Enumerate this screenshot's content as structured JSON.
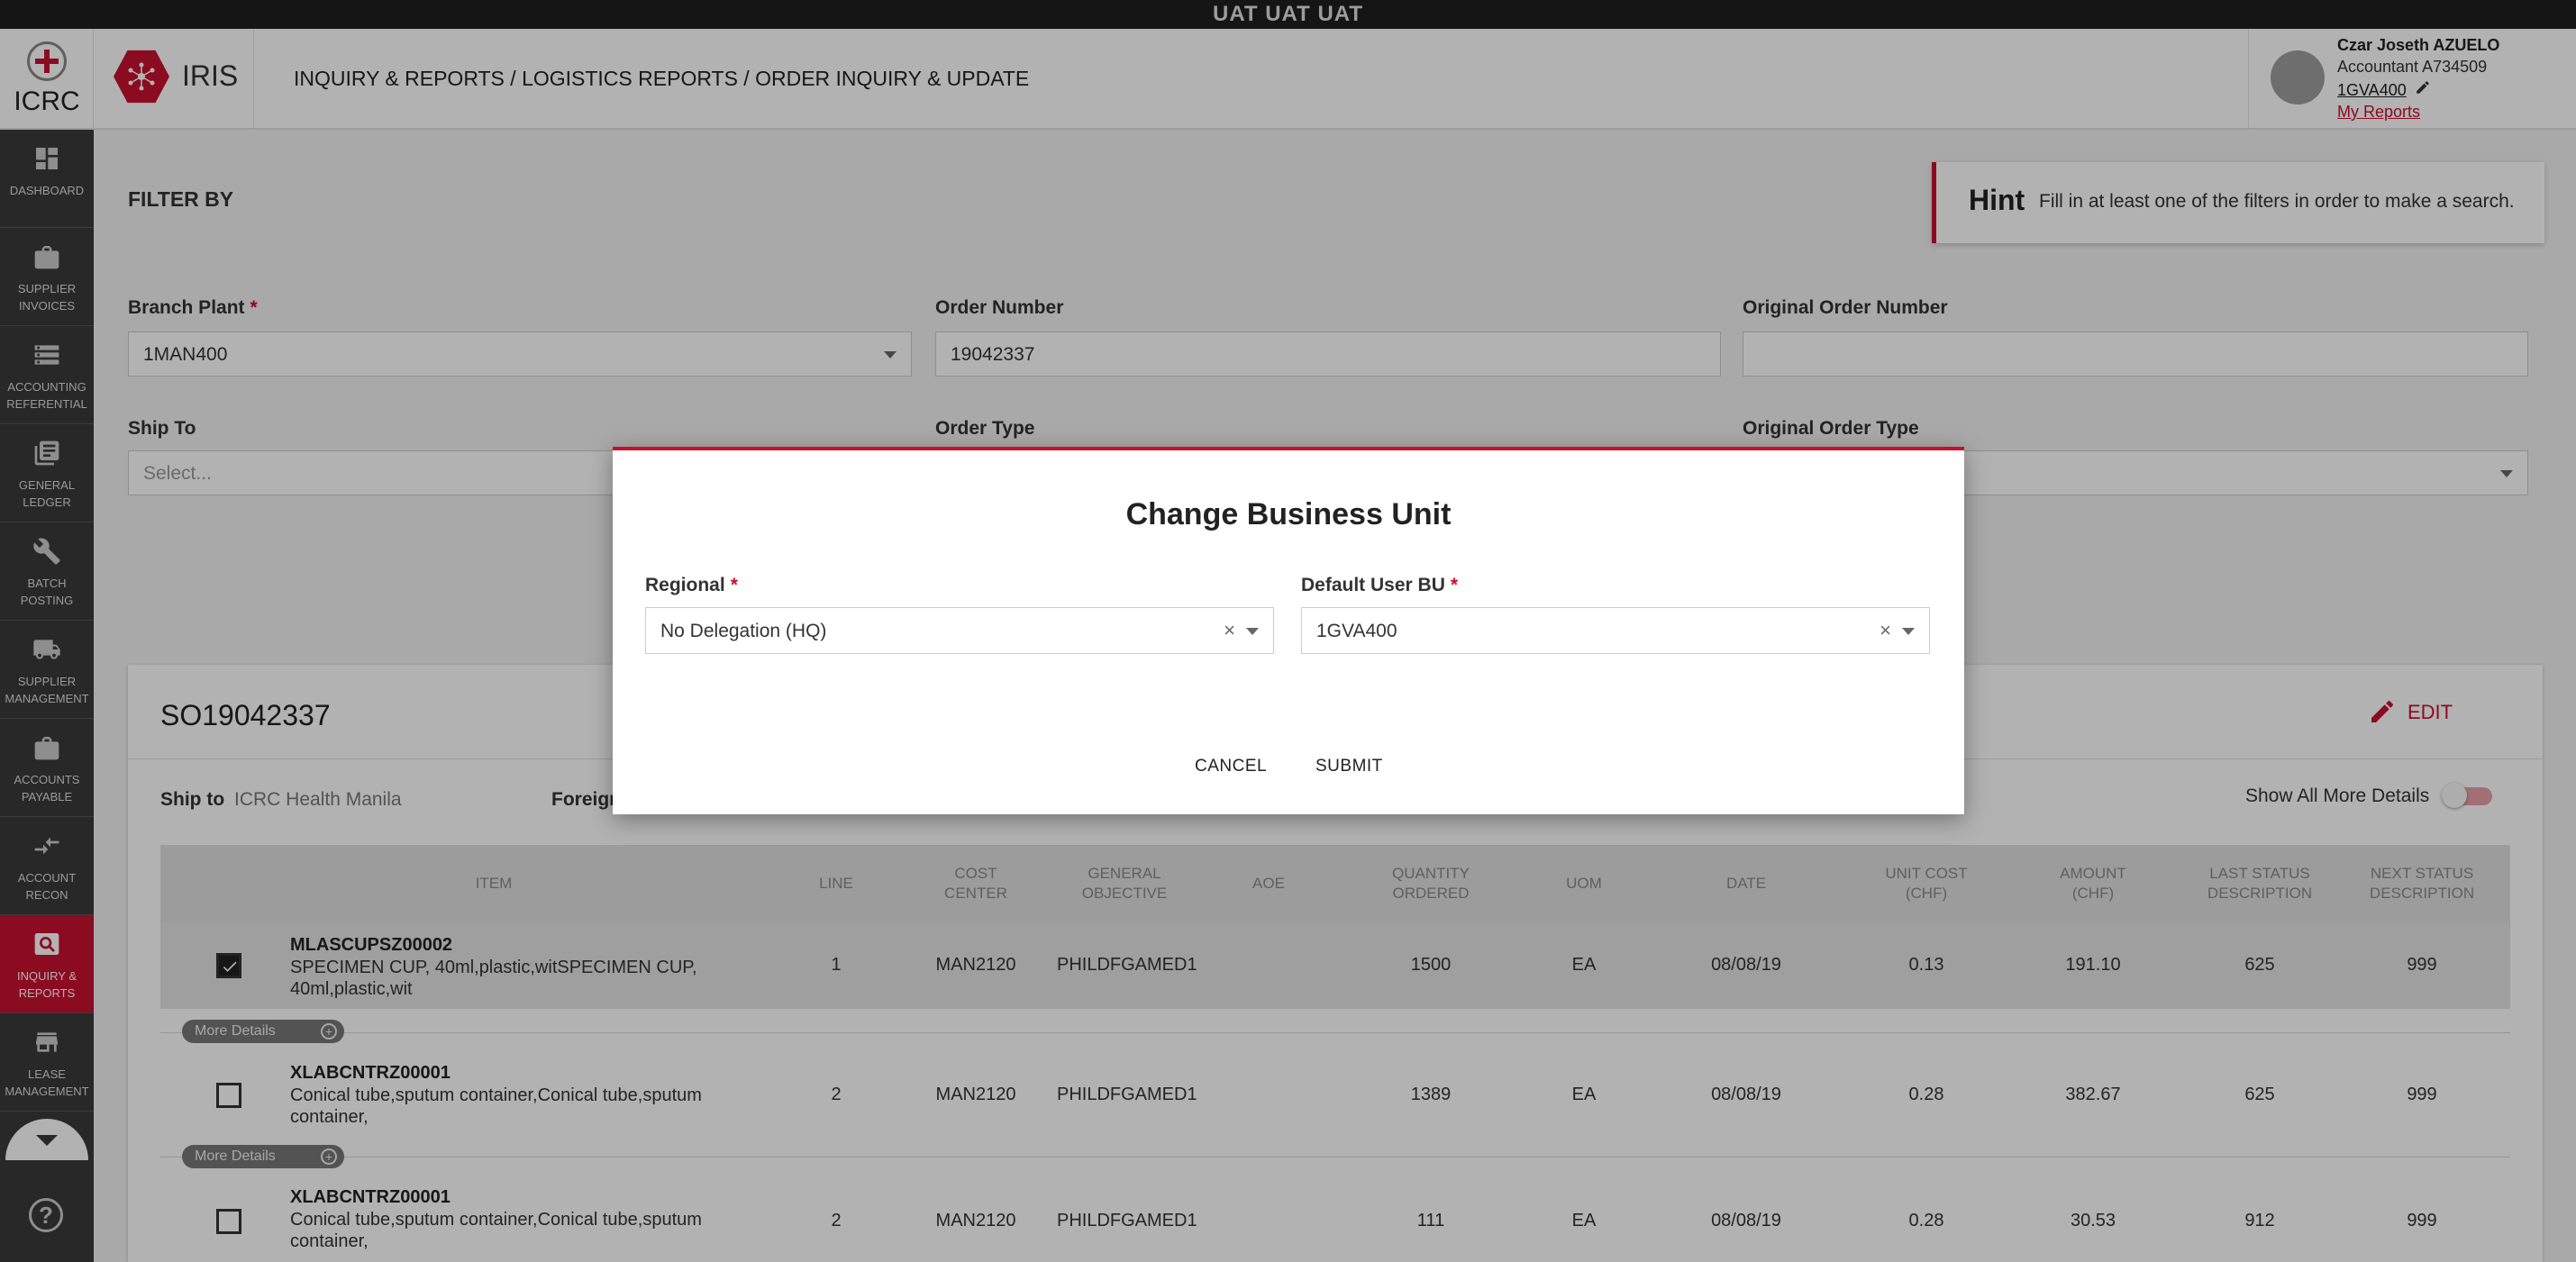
{
  "env_banner": "UAT UAT UAT",
  "brand": {
    "org": "ICRC",
    "app": "IRIS"
  },
  "breadcrumb": "INQUIRY & REPORTS / LOGISTICS REPORTS / ORDER INQUIRY & UPDATE",
  "user": {
    "name": "Czar Joseth AZUELO",
    "role": "Accountant A734509",
    "business_unit": "1GVA400",
    "my_reports": "My Reports"
  },
  "sidebar": {
    "items": [
      {
        "label": "DASHBOARD",
        "icon": "dashboard-icon"
      },
      {
        "label": "SUPPLIER INVOICES",
        "icon": "briefcase-icon"
      },
      {
        "label": "ACCOUNTING REFERENTIAL",
        "icon": "storage-icon"
      },
      {
        "label": "GENERAL LEDGER",
        "icon": "library-books-icon"
      },
      {
        "label": "BATCH POSTING",
        "icon": "wrench-icon"
      },
      {
        "label": "SUPPLIER MANAGEMENT",
        "icon": "truck-icon"
      },
      {
        "label": "ACCOUNTS PAYABLE",
        "icon": "briefcase-icon"
      },
      {
        "label": "ACCOUNT RECON",
        "icon": "compare-arrows-icon"
      },
      {
        "label": "INQUIRY & REPORTS",
        "icon": "search-icon",
        "active": true
      },
      {
        "label": "LEASE MANAGEMENT",
        "icon": "store-icon"
      }
    ]
  },
  "filter": {
    "title": "FILTER BY",
    "hint_title": "Hint",
    "hint_text": "Fill in at least one of the filters in order to make a search.",
    "branch_plant_label": "Branch Plant",
    "branch_plant_value": "1MAN400",
    "order_number_label": "Order Number",
    "order_number_value": "19042337",
    "original_order_number_label": "Original Order Number",
    "original_order_number_value": "",
    "ship_to_label": "Ship To",
    "ship_to_placeholder": "Select...",
    "order_type_label": "Order Type",
    "original_order_type_label": "Original Order Type"
  },
  "order": {
    "title": "SO19042337",
    "edit_label": "EDIT",
    "ship_to_label": "Ship to",
    "ship_to_value": "ICRC Health Manila",
    "foreign_label": "Foreign",
    "show_all_label": "Show All More Details",
    "columns": [
      "ITEM",
      "LINE",
      "COST CENTER",
      "GENERAL OBJECTIVE",
      "AOE",
      "QUANTITY ORDERED",
      "UOM",
      "DATE",
      "UNIT COST (CHF)",
      "AMOUNT (CHF)",
      "LAST STATUS DESCRIPTION",
      "NEXT STATUS DESCRIPTION"
    ],
    "more_details_label": "More Details",
    "rows": [
      {
        "checked": true,
        "item_code": "MLASCUPSZ00002",
        "item_desc": "SPECIMEN CUP, 40ml,plastic,witSPECIMEN CUP, 40ml,plastic,wit",
        "line": "1",
        "cost_center": "MAN2120",
        "general_objective": "PHILDFGAMED1",
        "aoe": "",
        "quantity": "1500",
        "uom": "EA",
        "date": "08/08/19",
        "unit_cost": "0.13",
        "amount": "191.10",
        "last_status": "625",
        "next_status": "999"
      },
      {
        "checked": false,
        "item_code": "XLABCNTRZ00001",
        "item_desc": "Conical tube,sputum container,Conical tube,sputum container,",
        "line": "2",
        "cost_center": "MAN2120",
        "general_objective": "PHILDFGAMED1",
        "aoe": "",
        "quantity": "1389",
        "uom": "EA",
        "date": "08/08/19",
        "unit_cost": "0.28",
        "amount": "382.67",
        "last_status": "625",
        "next_status": "999"
      },
      {
        "checked": false,
        "item_code": "XLABCNTRZ00001",
        "item_desc": "Conical tube,sputum container,Conical tube,sputum container,",
        "line": "2",
        "cost_center": "MAN2120",
        "general_objective": "PHILDFGAMED1",
        "aoe": "",
        "quantity": "111",
        "uom": "EA",
        "date": "08/08/19",
        "unit_cost": "0.28",
        "amount": "30.53",
        "last_status": "912",
        "next_status": "999"
      }
    ]
  },
  "modal": {
    "title": "Change Business Unit",
    "regional_label": "Regional",
    "regional_value": "No Delegation (HQ)",
    "default_bu_label": "Default User BU",
    "default_bu_value": "1GVA400",
    "cancel_label": "CANCEL",
    "submit_label": "SUBMIT"
  },
  "colors": {
    "accent": "#c8102e",
    "sidebar": "#3a3a3a",
    "env_bar": "#1f1f1f"
  }
}
